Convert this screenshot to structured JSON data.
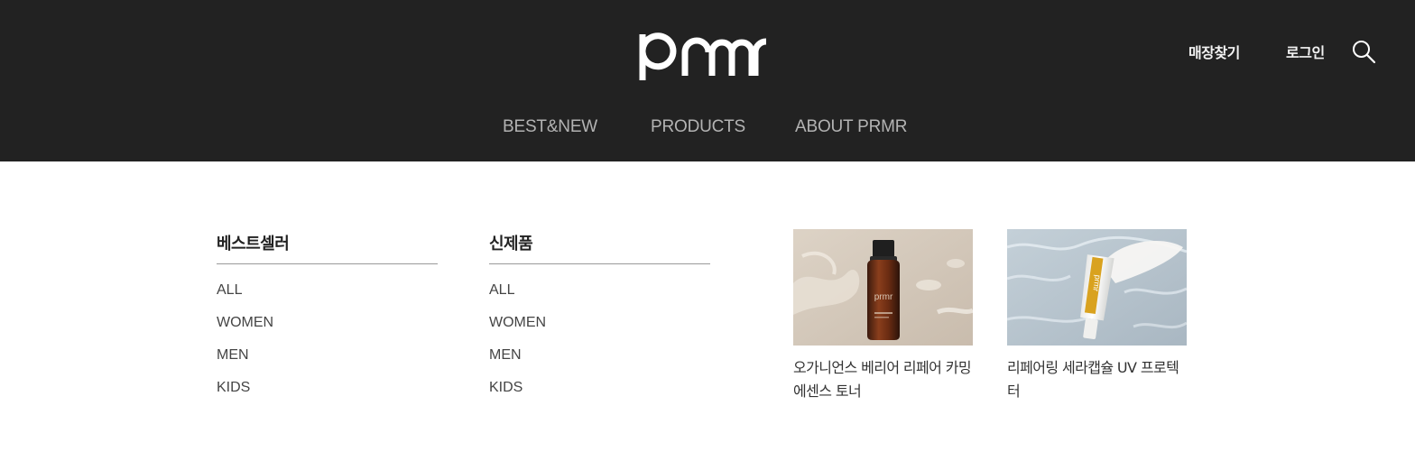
{
  "header": {
    "logo_text": "prmr",
    "store_finder": "매장찾기",
    "login": "로그인",
    "search_icon": "search-icon"
  },
  "nav": {
    "items": [
      {
        "label": "BEST&NEW"
      },
      {
        "label": "PRODUCTS"
      },
      {
        "label": "ABOUT PRMR"
      }
    ]
  },
  "menu": {
    "columns": [
      {
        "title": "베스트셀러",
        "items": [
          "ALL",
          "WOMEN",
          "MEN",
          "KIDS"
        ]
      },
      {
        "title": "신제품",
        "items": [
          "ALL",
          "WOMEN",
          "MEN",
          "KIDS"
        ]
      }
    ]
  },
  "products": [
    {
      "name": "오가니언스 베리어 리페어 카밍 에센스 토너"
    },
    {
      "name": "리페어링 세라캡슐 UV 프로텍터"
    }
  ]
}
